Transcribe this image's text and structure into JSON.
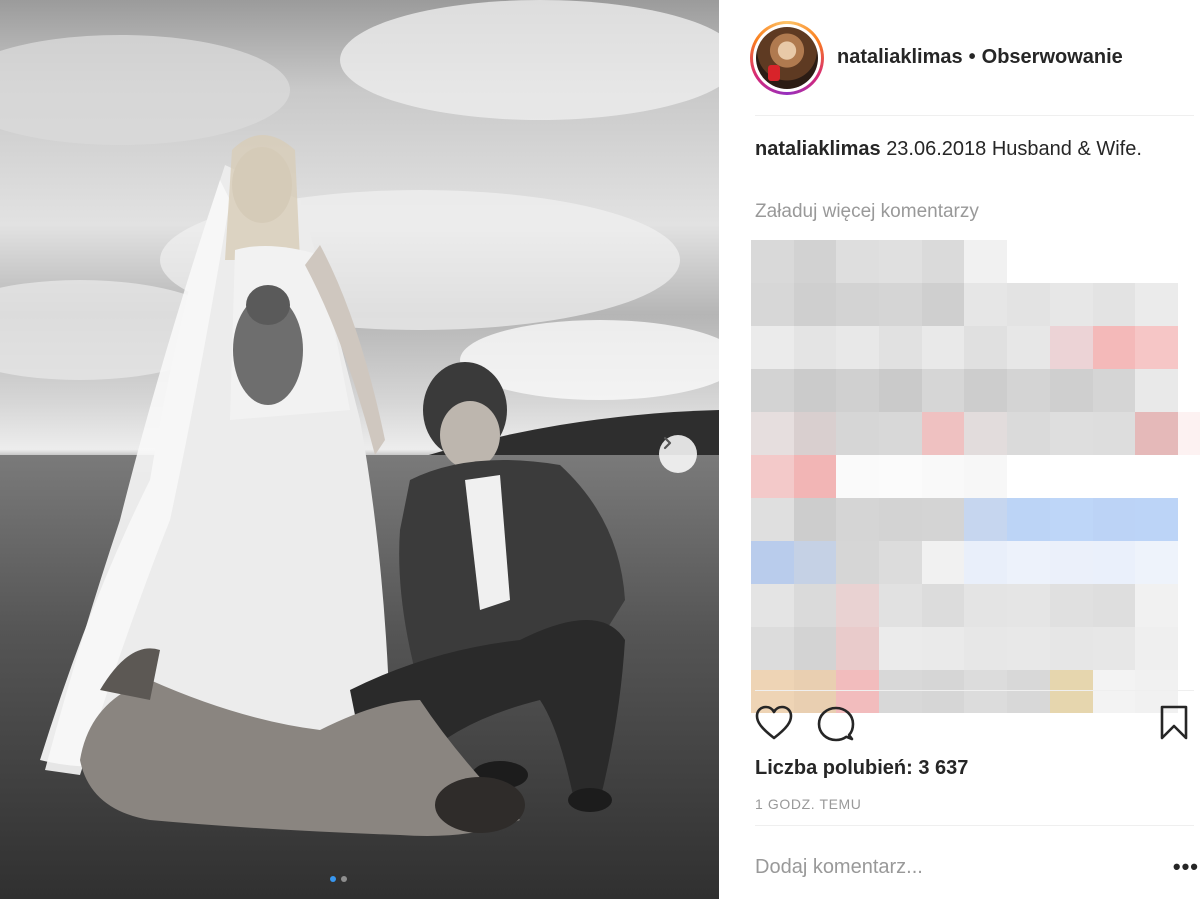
{
  "post": {
    "photo_alt_icon": "wedding-photo",
    "next_icon": "chevron-right-icon",
    "carousel_dots": 2
  },
  "header": {
    "username": "nataliaklimas",
    "separator": "•",
    "follow_label": "Obserwowanie"
  },
  "caption": {
    "username": "nataliaklimas",
    "text": "23.06.2018 Husband & Wife."
  },
  "comments": {
    "load_more": "Załaduj więcej komentarzy"
  },
  "actions": {
    "like_icon": "heart-icon",
    "comment_icon": "comment-icon",
    "save_icon": "bookmark-icon"
  },
  "likes": {
    "label": "Liczba polubień: 3 637"
  },
  "timestamp": "1 GODZ. TEMU",
  "add_comment": {
    "placeholder": "Dodaj komentarz..."
  },
  "more_options": "•••",
  "colors": {
    "accent_blue": "#3897f0",
    "text": "#262626",
    "muted": "#999999"
  }
}
